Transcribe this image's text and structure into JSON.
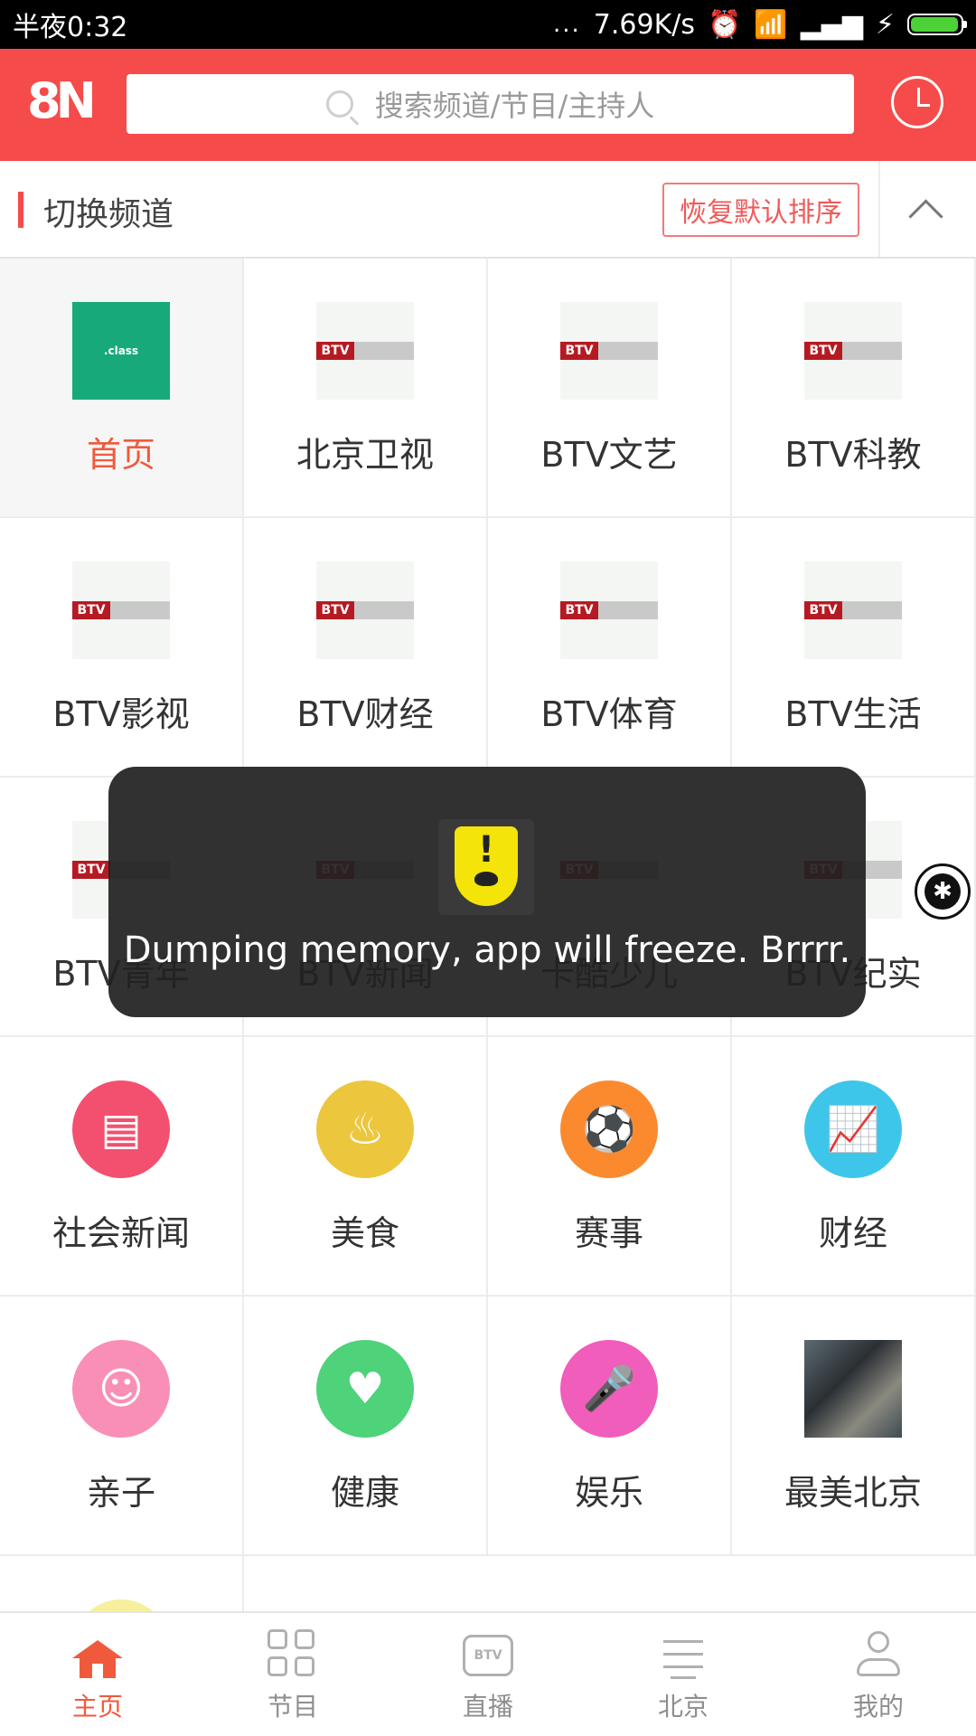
{
  "status_bar": {
    "time": "半夜0:32",
    "dots": "...",
    "net_speed": "7.69K/s"
  },
  "header": {
    "logo_text": "8N",
    "search_placeholder": "搜索频道/节目/主持人"
  },
  "section": {
    "title": "切换频道",
    "reset_label": "恢复默认排序"
  },
  "channels": [
    {
      "label": "首页",
      "thumb": "class-logo",
      "thumb_text": ".class",
      "active": true
    },
    {
      "label": "北京卫视",
      "thumb": "btv-logo"
    },
    {
      "label": "BTV文艺",
      "thumb": "btv-logo"
    },
    {
      "label": "BTV科教",
      "thumb": "btv-logo"
    },
    {
      "label": "BTV影视",
      "thumb": "btv-logo"
    },
    {
      "label": "BTV财经",
      "thumb": "btv-logo"
    },
    {
      "label": "BTV体育",
      "thumb": "btv-logo"
    },
    {
      "label": "BTV生活",
      "thumb": "btv-logo"
    },
    {
      "label": "BTV青年",
      "thumb": "btv-logo"
    },
    {
      "label": "BTV新闻",
      "thumb": "btv-logo"
    },
    {
      "label": "卡酷少儿",
      "thumb": "btv-logo"
    },
    {
      "label": "BTV纪实",
      "thumb": "btv-logo"
    },
    {
      "label": "社会新闻",
      "thumb": "round",
      "color": "#f2506e",
      "glyph": "▤"
    },
    {
      "label": "美食",
      "thumb": "round",
      "color": "#ecc63c",
      "glyph": "♨"
    },
    {
      "label": "赛事",
      "thumb": "round",
      "color": "#fb8a2e",
      "glyph": "⚽"
    },
    {
      "label": "财经",
      "thumb": "round",
      "color": "#3dc6ea",
      "glyph": "📈"
    },
    {
      "label": "亲子",
      "thumb": "round",
      "color": "#f98fb6",
      "glyph": "☺"
    },
    {
      "label": "健康",
      "thumb": "round",
      "color": "#4ed27a",
      "glyph": "♥"
    },
    {
      "label": "娱乐",
      "thumb": "round",
      "color": "#f05dbb",
      "glyph": "🎤"
    },
    {
      "label": "最美北京",
      "thumb": "photo"
    },
    {
      "label": "",
      "thumb": "round",
      "color": "#f6ef9c",
      "glyph": ""
    }
  ],
  "toast": {
    "message": "Dumping memory, app will freeze. Brrrr."
  },
  "bottom_nav": [
    {
      "label": "主页",
      "icon": "home-icon",
      "active": true
    },
    {
      "label": "节目",
      "icon": "grid-icon"
    },
    {
      "label": "直播",
      "icon": "tv-icon",
      "icon_text": "BTV"
    },
    {
      "label": "北京",
      "icon": "pagoda-icon"
    },
    {
      "label": "我的",
      "icon": "person-icon"
    }
  ]
}
